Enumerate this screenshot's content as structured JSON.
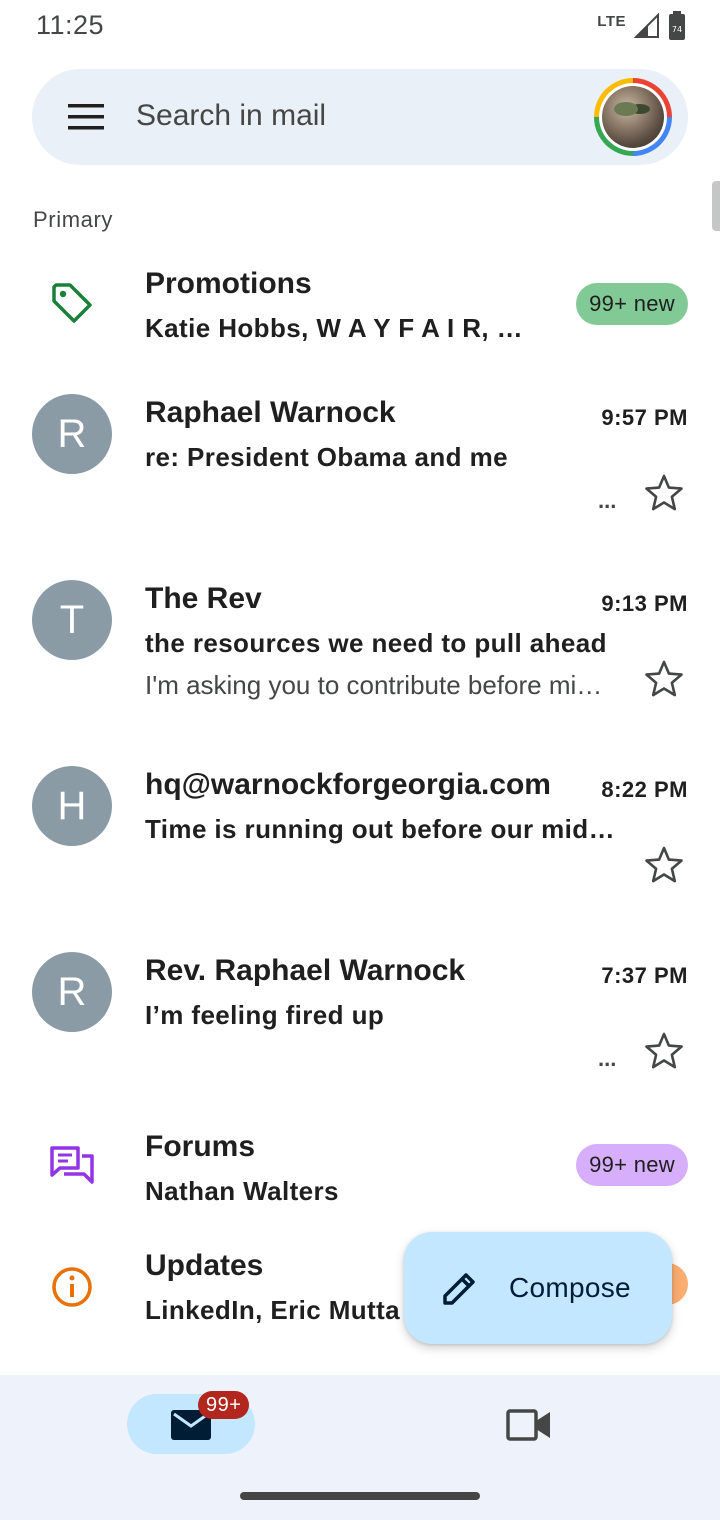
{
  "status_bar": {
    "time": "11:25",
    "network": "LTE"
  },
  "search": {
    "placeholder": "Search in mail"
  },
  "section": {
    "label": "Primary"
  },
  "promotions": {
    "title": "Promotions",
    "senders": "Katie Hobbs, W A Y F A I R, Wayfair",
    "badge": "99+ new",
    "badge_color": "#81c995"
  },
  "emails": [
    {
      "initial": "R",
      "sender": "Raphael Warnock",
      "time": "9:57 PM",
      "subject": "re: President Obama and me",
      "snippet": "",
      "more": "..."
    },
    {
      "initial": "T",
      "sender": "The Rev",
      "time": "9:13 PM",
      "subject": "the resources we need to pull ahead",
      "snippet": "I'm asking you to contribute before midnight",
      "more": ""
    },
    {
      "initial": "H",
      "sender": "hq@warnockforgeorgia.com",
      "time": "8:22 PM",
      "subject": "Time is running out before our midnight deadline",
      "snippet": "",
      "more": ""
    },
    {
      "initial": "R",
      "sender": "Rev. Raphael Warnock",
      "time": "7:37 PM",
      "subject": "I’m feeling fired up",
      "snippet": "",
      "more": "..."
    }
  ],
  "forums": {
    "title": "Forums",
    "senders": "Nathan Walters",
    "badge": "99+ new",
    "badge_color": "#d7aefb"
  },
  "updates": {
    "title": "Updates",
    "senders": "LinkedIn, Eric Mutta",
    "badge_color": "#fcad70"
  },
  "compose": {
    "label": "Compose"
  },
  "bottom_nav": {
    "mail_badge": "99+"
  },
  "colors": {
    "accent": "#c2e7ff",
    "avatar": "#8a9ba5",
    "badge_red": "#b3261e"
  }
}
